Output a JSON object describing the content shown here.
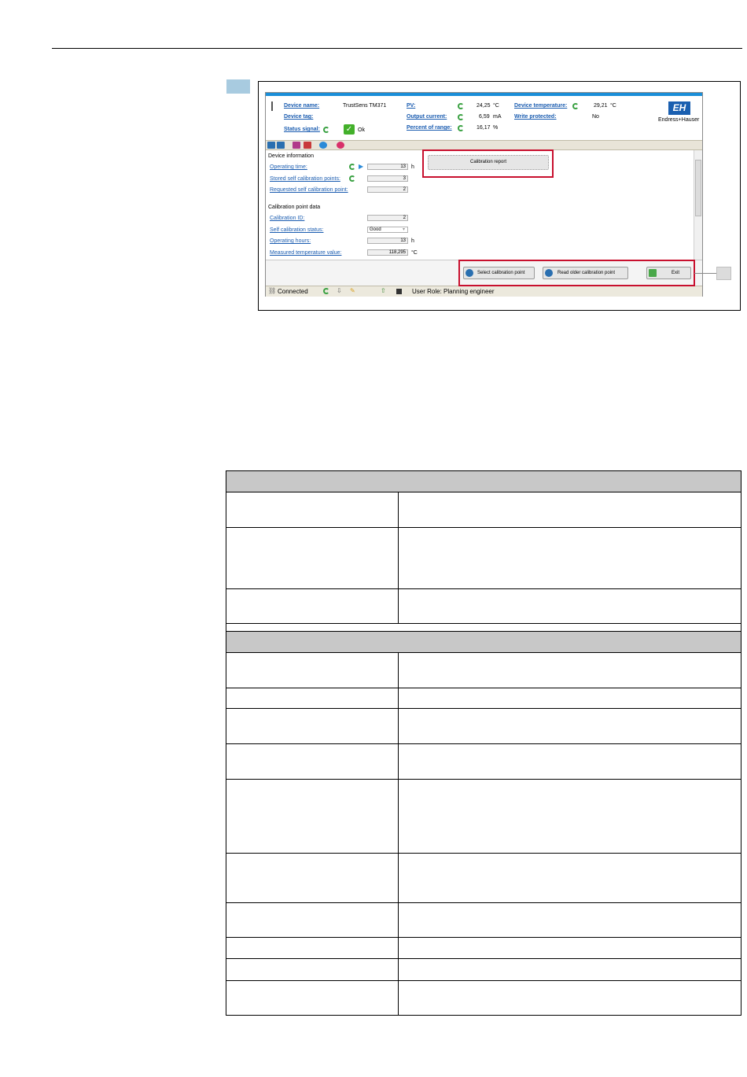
{
  "header": {
    "device_name_label": "Device name:",
    "device_name_value": "TrustSens TM371",
    "device_tag_label": "Device tag:",
    "status_signal_label": "Status signal:",
    "status_signal_value": "Ok",
    "pv_label": "PV:",
    "pv_value": "24,25",
    "pv_unit": "°C",
    "output_current_label": "Output current:",
    "output_current_value": "6,59",
    "output_current_unit": "mA",
    "percent_range_label": "Percent of range:",
    "percent_range_value": "16,17",
    "percent_range_unit": "%",
    "device_temp_label": "Device temperature:",
    "device_temp_value": "29,21",
    "device_temp_unit": "°C",
    "write_protected_label": "Write protected:",
    "write_protected_value": "No",
    "brand": "Endress+Hauser"
  },
  "device_info": {
    "heading": "Device information",
    "rows": [
      {
        "label": "Operating time:",
        "value": "13",
        "unit": "h"
      },
      {
        "label": "Stored self calibration points:",
        "value": "3",
        "unit": ""
      },
      {
        "label": "Requested self calibration point:",
        "value": "2",
        "unit": ""
      }
    ]
  },
  "calib_data": {
    "heading": "Calibration point data",
    "rows": [
      {
        "label": "Calibration ID:",
        "value": "2",
        "unit": ""
      },
      {
        "label": "Self calibration status:",
        "value": "Good",
        "unit": ""
      },
      {
        "label": "Operating hours:",
        "value": "13",
        "unit": "h"
      },
      {
        "label": "Measured temperature value:",
        "value": "118,295",
        "unit": "°C"
      }
    ]
  },
  "buttons": {
    "calibration_report": "Calibration report",
    "select_point": "Select calibration point",
    "read_older": "Read older calibration point",
    "exit": "Exit"
  },
  "status": {
    "connected": "Connected",
    "user_role": "User Role: Planning engineer"
  },
  "colors": {
    "accent_blue": "#1a8ed8",
    "highlight_red": "#c8102e",
    "section_gray": "#c8c8c8"
  }
}
